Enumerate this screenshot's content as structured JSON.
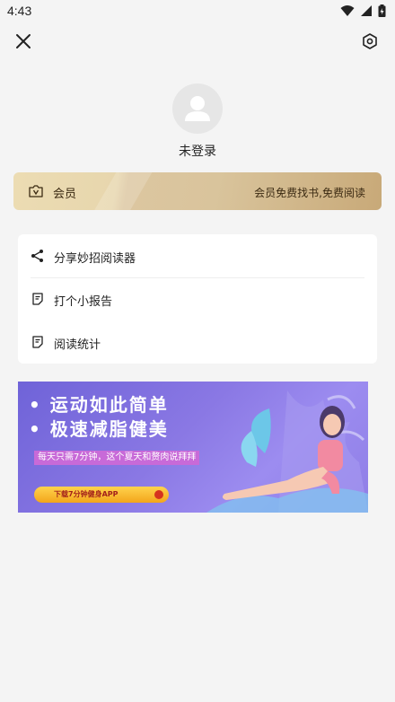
{
  "status_bar": {
    "time": "4:43",
    "icons": [
      "wifi-icon",
      "cellular-signal-icon",
      "battery-icon"
    ]
  },
  "top_bar": {
    "close_icon": "close-icon",
    "settings_icon": "settings-icon"
  },
  "profile": {
    "avatar_icon": "user-avatar-icon",
    "login_status": "未登录"
  },
  "vip": {
    "icon": "vip-icon",
    "label": "会员",
    "description": "会员免费找书,免费阅读"
  },
  "menu": {
    "items": [
      {
        "icon": "share-icon",
        "label": "分享妙招阅读器"
      },
      {
        "icon": "report-icon",
        "label": "打个小报告"
      },
      {
        "icon": "stats-icon",
        "label": "阅读统计"
      }
    ]
  },
  "ad": {
    "line1": "• 运动如此简单",
    "line2": "• 极速减脂健美",
    "subtitle": "每天只需7分钟，这个夏天和赘肉说拜拜",
    "button_label": "下载7分钟健身APP"
  },
  "colors": {
    "background": "#f4f4f4",
    "vip_gold": "#d9c49c",
    "ad_purple": "#8a78e4"
  }
}
